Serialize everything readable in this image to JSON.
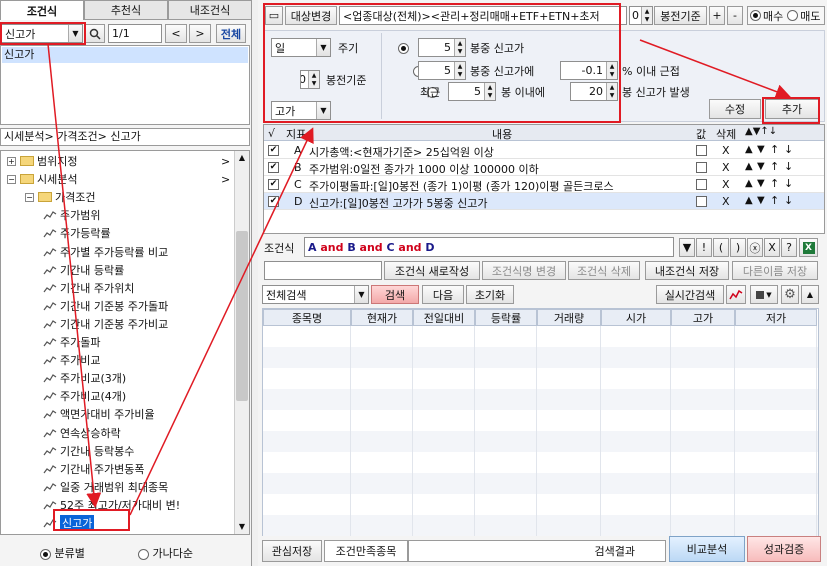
{
  "left_tabs": [
    {
      "label": "조건식",
      "active": true
    },
    {
      "label": "추천식",
      "active": false
    },
    {
      "label": "내조건식",
      "active": false
    }
  ],
  "search": {
    "value": "신고가",
    "page": "1/1",
    "all_button": "전체"
  },
  "search_result": "신고가",
  "breadcrumb": "시세분석> 가격조건> 신고가",
  "tree": [
    {
      "label": "범위지정",
      "level": 0,
      "type": "folder",
      "expanded": false
    },
    {
      "label": "시세분석",
      "level": 0,
      "type": "folder",
      "expanded": true
    },
    {
      "label": "가격조건",
      "level": 1,
      "type": "folder",
      "expanded": true
    },
    {
      "label": "주가범위",
      "level": 2,
      "type": "item"
    },
    {
      "label": "주가등락률",
      "level": 2,
      "type": "item"
    },
    {
      "label": "주가별 주가등락률 비교",
      "level": 2,
      "type": "item"
    },
    {
      "label": "기간내 등락률",
      "level": 2,
      "type": "item"
    },
    {
      "label": "기간내 주가위치",
      "level": 2,
      "type": "item"
    },
    {
      "label": "기간내 기준봉 주가돌파",
      "level": 2,
      "type": "item"
    },
    {
      "label": "기간내 기준봉 주가비교",
      "level": 2,
      "type": "item"
    },
    {
      "label": "주가돌파",
      "level": 2,
      "type": "item"
    },
    {
      "label": "주가비교",
      "level": 2,
      "type": "item"
    },
    {
      "label": "주가비교(3개)",
      "level": 2,
      "type": "item"
    },
    {
      "label": "주가비교(4개)",
      "level": 2,
      "type": "item"
    },
    {
      "label": "액면가대비 주가비율",
      "level": 2,
      "type": "item"
    },
    {
      "label": "연속상승하락",
      "level": 2,
      "type": "item"
    },
    {
      "label": "기간내 등락봉수",
      "level": 2,
      "type": "item"
    },
    {
      "label": "기간내 주가변동폭",
      "level": 2,
      "type": "item"
    },
    {
      "label": "일중 거래범위 최대종목",
      "level": 2,
      "type": "item"
    },
    {
      "label": "52주 최고가/저가대비 변!",
      "level": 2,
      "type": "item"
    },
    {
      "label": "신고가",
      "level": 2,
      "type": "item",
      "selected": true
    }
  ],
  "sort_options": [
    {
      "label": "분류별",
      "checked": true
    },
    {
      "label": "가나다순",
      "checked": false
    }
  ],
  "target": {
    "button": "대상변경",
    "text": "<업종대상(전체)><관리+정리매매+ETF+ETN+초저",
    "bong_value": "0",
    "bong_label": "봉전기준",
    "plus": "+",
    "minus": "-",
    "buy": "매수",
    "sell": "매도"
  },
  "params": {
    "period": "일",
    "period_label": "주기",
    "base_value": "0",
    "base_label": "봉전기준",
    "price_type": "고가",
    "opt1": {
      "value": "5",
      "text": "봉중 신고가"
    },
    "opt2": {
      "value": "5",
      "text": "봉중 신고가에",
      "pct": "-0.1",
      "suffix": "% 이내 근접"
    },
    "opt3": {
      "prefix": "최근",
      "value": "5",
      "text": "봉 이내에",
      "count": "20",
      "suffix": "봉 신고가 발생"
    },
    "edit_button": "수정",
    "add_button": "추가"
  },
  "cond_table": {
    "headers": [
      "√",
      "지표",
      "내용",
      "값",
      "삭제"
    ],
    "rows": [
      {
        "checked": true,
        "id": "A",
        "content": "시가총액:<현재가기준> 25십억원 이상",
        "del": "X"
      },
      {
        "checked": true,
        "id": "B",
        "content": "주가범위:0일전 종가가 1000 이상 100000 이하",
        "del": "X"
      },
      {
        "checked": true,
        "id": "C",
        "content": "주가이평돌파:[일]0봉전 (종가 1)이평 (종가 120)이평 골든크로스",
        "del": "X"
      },
      {
        "checked": true,
        "id": "D",
        "content": "신고가:[일]0봉전 고가가 5봉중 신고가",
        "del": "X",
        "selected": true
      }
    ]
  },
  "formula": {
    "label": "조건식",
    "text": "A and B and C and D",
    "tools": [
      "▼",
      "!",
      "(",
      ")",
      "ⓧ",
      "X",
      "?"
    ]
  },
  "actions": {
    "new": "조건식 새로작성",
    "change": "조건식명 변경",
    "delete": "조건식 삭제",
    "save": "내조건식 저장",
    "save_as": "다른이름 저장"
  },
  "search_bar": {
    "mode": "전체검색",
    "search": "검색",
    "next": "다음",
    "reset": "초기화",
    "realtime": "실시간검색"
  },
  "result_headers": [
    "종목명",
    "현재가",
    "전일대비",
    "등락률",
    "거래량",
    "시가",
    "고가",
    "저가"
  ],
  "bottom": {
    "interest": "관심저장",
    "count_label": "조건만족종목",
    "result_label": "검색결과",
    "compare": "비교분석",
    "verify": "성과검증"
  },
  "colors": {
    "accent_red": "#e01b24",
    "selected_blue": "#0a64d8",
    "and_red": "#d0021b"
  }
}
